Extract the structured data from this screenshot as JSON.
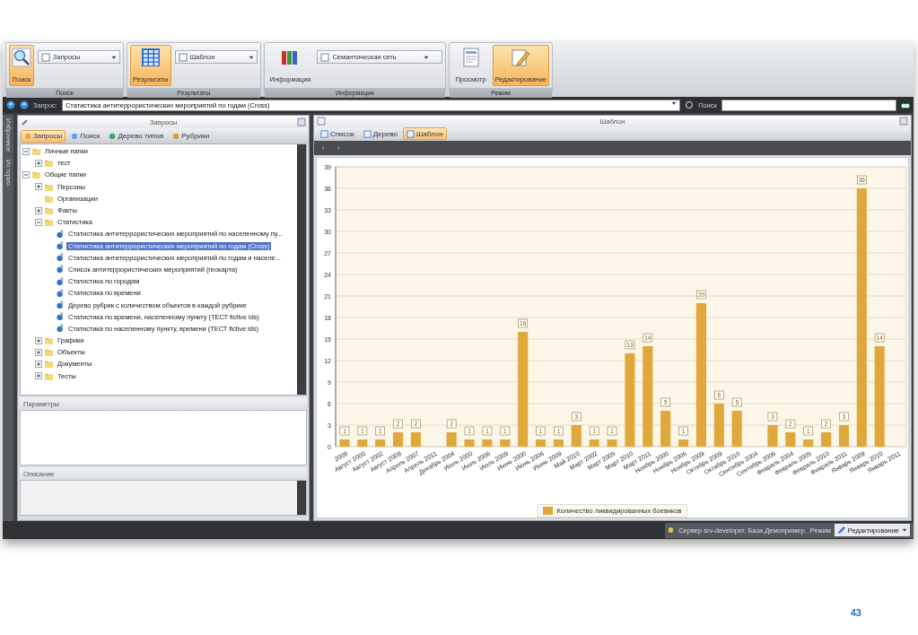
{
  "ribbon": {
    "groups": [
      {
        "label": "Поиск",
        "buttons": [
          {
            "label": "Поиск",
            "selected": true
          }
        ],
        "dropdown": {
          "value": "Запросы",
          "more": false
        }
      },
      {
        "label": "Результаты",
        "buttons": [
          {
            "label": "Результаты",
            "selected": true
          }
        ],
        "dropdown": {
          "value": "Шаблон",
          "more": false
        }
      },
      {
        "label": "Информация",
        "buttons": [
          {
            "label": "Информация",
            "selected": false
          }
        ],
        "dropdown": {
          "value": "Семантическая сеть",
          "more": true
        }
      },
      {
        "label": "Режим",
        "buttons": [
          {
            "label": "Просмотр",
            "selected": false
          },
          {
            "label": "Редактирование",
            "selected": true
          }
        ]
      }
    ]
  },
  "query_bar": {
    "label": "Запрос:",
    "value": "Статистика антитеррористических мероприятий по годам (Cross)",
    "search_label": "Поиск"
  },
  "side_strip": [
    "Избранное",
    "История"
  ],
  "left_panel": {
    "title": "Запросы",
    "tabs": [
      {
        "label": "Запросы",
        "selected": true
      },
      {
        "label": "Поиск",
        "selected": false
      },
      {
        "label": "Дерево типов",
        "selected": false
      },
      {
        "label": "Рубрики",
        "selected": false
      }
    ],
    "tree": [
      {
        "kind": "folder",
        "label": "Личные папки",
        "expanded": true,
        "selected": false,
        "children": [
          {
            "kind": "folder",
            "label": "тест",
            "expanded": false,
            "selected": false
          }
        ]
      },
      {
        "kind": "folder",
        "label": "Общие папки",
        "expanded": true,
        "selected": false,
        "children": [
          {
            "kind": "folder",
            "label": "Персоны",
            "expanded": false,
            "selected": false
          },
          {
            "kind": "empty_folder",
            "label": "Организации",
            "selected": false
          },
          {
            "kind": "folder",
            "label": "Факты",
            "expanded": false,
            "selected": false
          },
          {
            "kind": "folder",
            "label": "Статистика",
            "expanded": true,
            "selected": false,
            "children": [
              {
                "kind": "query",
                "label": "Статистика антитеррористических мероприятий по населенному пу...",
                "selected": false
              },
              {
                "kind": "query",
                "label": "Статистика антитеррористических мероприятий по годам (Cross)",
                "selected": true
              },
              {
                "kind": "query",
                "label": "Статистика антитеррористических мероприятий по годам и населе...",
                "selected": false
              },
              {
                "kind": "query",
                "label": "Список антитеррористических мероприятий (геокарта)",
                "selected": false
              },
              {
                "kind": "query",
                "label": "Статистика по городам",
                "selected": false
              },
              {
                "kind": "query",
                "label": "Статистика по времени",
                "selected": false
              },
              {
                "kind": "query",
                "label": "Дерево рубрик с количеством объектов в каждой рубрике",
                "selected": false
              },
              {
                "kind": "query",
                "label": "Статистика по времени, населенному пункту (ТЕСТ fictive ids)",
                "selected": false
              },
              {
                "kind": "query",
                "label": "Статистика по населенному пункту, времени (ТЕСТ fictive ids)",
                "selected": false
              }
            ]
          },
          {
            "kind": "folder",
            "label": "Графики",
            "expanded": false,
            "selected": false
          },
          {
            "kind": "folder",
            "label": "Объекты",
            "expanded": false,
            "selected": false
          },
          {
            "kind": "folder",
            "label": "Документы",
            "expanded": false,
            "selected": false
          },
          {
            "kind": "folder",
            "label": "Тесты",
            "expanded": false,
            "selected": false
          }
        ]
      }
    ],
    "sections": [
      "Параметры",
      "Описание"
    ]
  },
  "right_panel": {
    "title": "Шаблон",
    "tabs": [
      {
        "label": "Список",
        "selected": false
      },
      {
        "label": "Дерево",
        "selected": false
      },
      {
        "label": "Шаблон",
        "selected": true
      }
    ],
    "chart_data": {
      "type": "bar",
      "categories": [
        "2009",
        "Август 2000",
        "Август 2002",
        "Август 2009",
        "Апрель 2007",
        "Апрель 2011",
        "Декабрь 2004",
        "Июль 2000",
        "Июль 2006",
        "Июль 2009",
        "Июнь 2000",
        "Июнь 2006",
        "Июнь 2009",
        "Май 2010",
        "Март 2002",
        "Март 2005",
        "Март 2010",
        "Март 2011",
        "Ноябрь 2000",
        "Ноябрь 2006",
        "Ноябрь 2009",
        "Октябрь 2009",
        "Октябрь 2010",
        "Сентябрь 2004",
        "Сентябрь 2006",
        "Февраль 2004",
        "Февраль 2005",
        "Февраль 2010",
        "Февраль 2011",
        "Январь 2009",
        "Январь 2010",
        "Январь 2011"
      ],
      "series": [
        {
          "name": "Количество ликвидированных боевиков",
          "color": "#e0a83a",
          "values": [
            1,
            1,
            1,
            2,
            2,
            null,
            2,
            1,
            1,
            1,
            16,
            1,
            1,
            3,
            1,
            1,
            13,
            14,
            5,
            1,
            20,
            6,
            5,
            null,
            3,
            2,
            1,
            2,
            3,
            36,
            14,
            null
          ]
        }
      ],
      "ylim": [
        0,
        39
      ],
      "grid": true,
      "yticks": [
        0,
        3,
        6,
        9,
        12,
        15,
        18,
        21,
        24,
        27,
        30,
        33,
        36,
        39
      ],
      "data_labels": true
    }
  },
  "status_bar": {
    "server": "Сервер srv-developer. База Демопример.",
    "mode_label": "Режим",
    "mode_value": "Редактирование"
  },
  "page_number": "43"
}
